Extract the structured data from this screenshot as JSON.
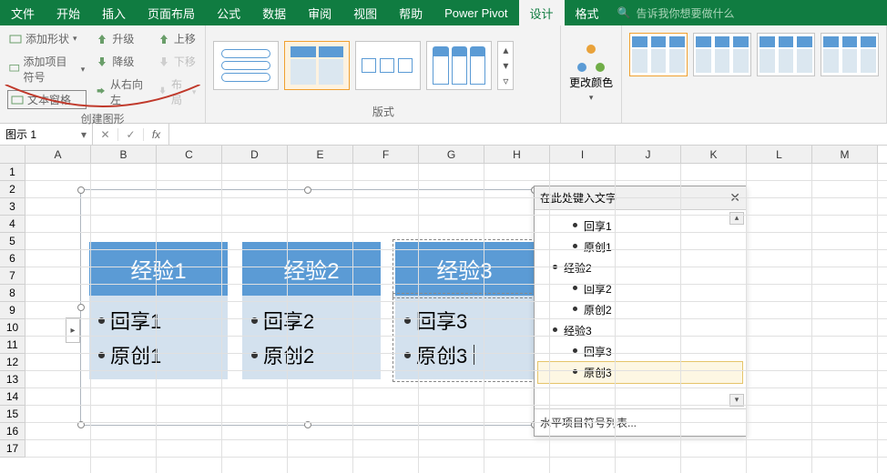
{
  "menu": {
    "items": [
      "文件",
      "开始",
      "插入",
      "页面布局",
      "公式",
      "数据",
      "审阅",
      "视图",
      "帮助",
      "Power Pivot",
      "设计",
      "格式"
    ],
    "active_index": 10,
    "tell_me_placeholder": "告诉我你想要做什么"
  },
  "ribbon": {
    "create_shape": {
      "label": "创建图形",
      "col1": [
        "添加形状",
        "添加项目符号",
        "文本窗格"
      ],
      "col2": [
        "升级",
        "降级",
        "从右向左"
      ],
      "col3": [
        "上移",
        "下移",
        "布局"
      ],
      "highlighted_index": 2
    },
    "layouts": {
      "label": "版式",
      "selected_index": 1
    },
    "colors": {
      "label": "更改颜色"
    },
    "styles": {
      "selected_index": 0
    }
  },
  "name_box": {
    "value": "图示 1",
    "fx": "fx"
  },
  "grid": {
    "cols": [
      "A",
      "B",
      "C",
      "D",
      "E",
      "F",
      "G",
      "H",
      "I",
      "J",
      "K",
      "L",
      "M"
    ],
    "rows": [
      1,
      2,
      3,
      4,
      5,
      6,
      7,
      8,
      9,
      10,
      11,
      12,
      13,
      14,
      15,
      16,
      17
    ]
  },
  "smartart": {
    "columns": [
      {
        "title": "经验1",
        "items": [
          "回享1",
          "原创1"
        ]
      },
      {
        "title": "经验2",
        "items": [
          "回享2",
          "原创2"
        ]
      },
      {
        "title": "经验3",
        "items": [
          "回享3",
          "原创3"
        ]
      }
    ],
    "editing_col": 2,
    "cursor_item": [
      2,
      1
    ]
  },
  "text_pane": {
    "title": "在此处键入文字",
    "footer": "水平项目符号列表...",
    "items": [
      {
        "level": 2,
        "text": "回享1"
      },
      {
        "level": 2,
        "text": "原创1"
      },
      {
        "level": 1,
        "text": "经验2"
      },
      {
        "level": 2,
        "text": "回享2"
      },
      {
        "level": 2,
        "text": "原创2"
      },
      {
        "level": 1,
        "text": "经验3"
      },
      {
        "level": 2,
        "text": "回享3"
      },
      {
        "level": 2,
        "text": "原创3"
      }
    ],
    "selected_index": 7
  },
  "chart_data": {
    "type": "table",
    "note": "SmartArt horizontal bullet list with 3 columns",
    "series": [
      {
        "name": "经验1",
        "values": [
          "回享1",
          "原创1"
        ]
      },
      {
        "name": "经验2",
        "values": [
          "回享2",
          "原创2"
        ]
      },
      {
        "name": "经验3",
        "values": [
          "回享3",
          "原创3"
        ]
      }
    ]
  }
}
